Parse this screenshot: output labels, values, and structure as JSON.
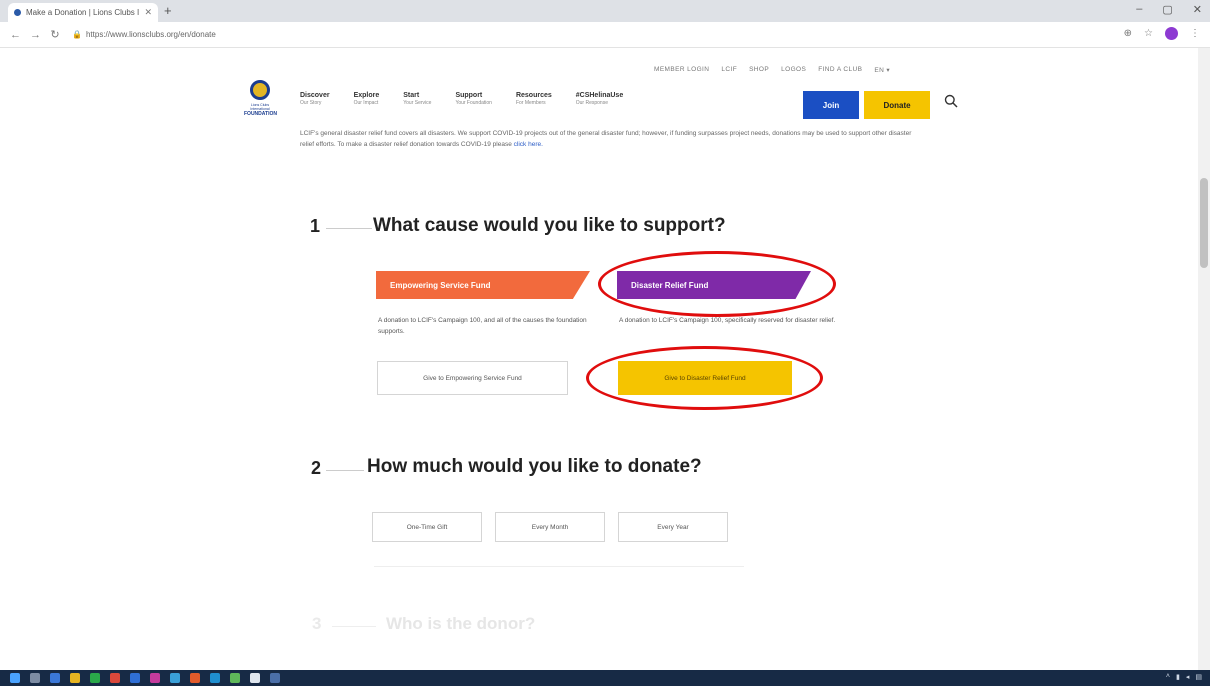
{
  "browser": {
    "tab_title": "Make a Donation | Lions Clubs I...",
    "new_tab": "+",
    "url": "https://www.lionsclubs.org/en/donate",
    "win_min": "–",
    "win_max": "▢",
    "win_close": "✕"
  },
  "utility_nav": [
    "MEMBER LOGIN",
    "LCIF",
    "SHOP",
    "LOGOS",
    "FIND A CLUB",
    "EN ▾"
  ],
  "logo": {
    "small": "Lions Clubs International",
    "big": "FOUNDATION"
  },
  "main_nav": [
    {
      "title": "Discover",
      "sub": "Our Story"
    },
    {
      "title": "Explore",
      "sub": "Our Impact"
    },
    {
      "title": "Start",
      "sub": "Your Service"
    },
    {
      "title": "Support",
      "sub": "Your Foundation"
    },
    {
      "title": "Resources",
      "sub": "For Members"
    },
    {
      "title": "#CSHelinaUse",
      "sub": "Our Response"
    }
  ],
  "buttons": {
    "join": "Join",
    "donate": "Donate"
  },
  "intro": {
    "text": "LCIF's general disaster relief fund covers all disasters. We support COVID-19 projects out of the general disaster fund; however, if funding surpasses project needs, donations may be used to support other disaster relief efforts. To make a disaster relief donation towards COVID-19 please",
    "link": "click here."
  },
  "step1": {
    "number": "1",
    "title": "What cause would you like to support?",
    "funds": [
      {
        "name": "Empowering Service Fund",
        "color": "#f26a3d",
        "desc": "A donation to LCIF's Campaign 100, and all of the causes the foundation supports.",
        "button": "Give to Empowering Service Fund"
      },
      {
        "name": "Disaster Relief Fund",
        "color": "#7f2aa8",
        "desc": "A donation to LCIF's Campaign 100, specifically reserved for disaster relief.",
        "button": "Give to Disaster Relief Fund"
      }
    ]
  },
  "step2": {
    "number": "2",
    "title": "How much would you like to donate?",
    "options": [
      "One-Time Gift",
      "Every Month",
      "Every Year"
    ]
  },
  "step3": {
    "number": "3",
    "title": "Who is the donor?"
  },
  "annotation_color": "#e00d0d"
}
